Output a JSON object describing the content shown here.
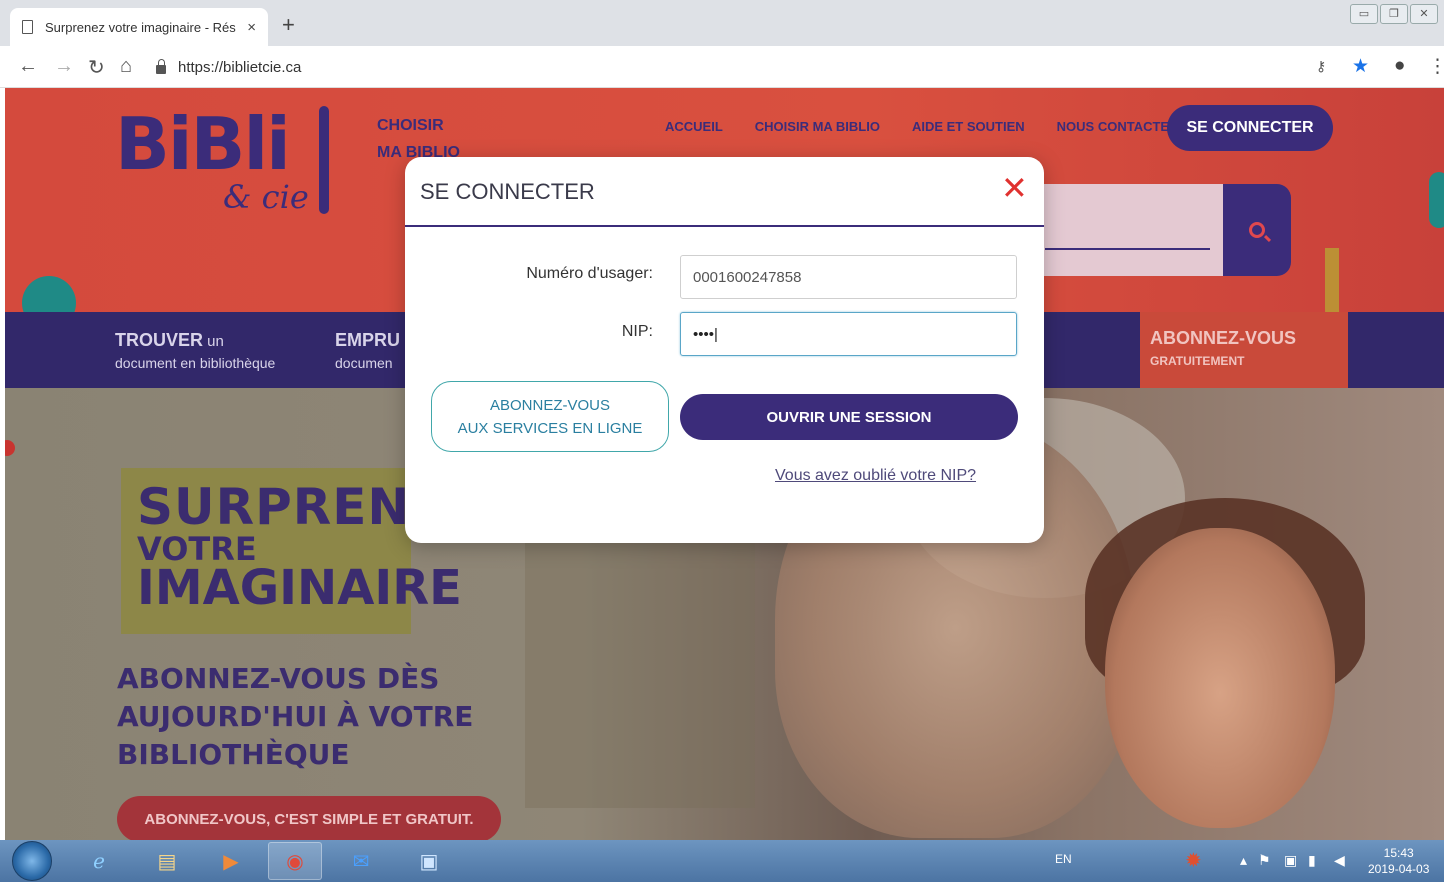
{
  "browser": {
    "tab_title": "Surprenez votre imaginaire - Rés",
    "tab_close": "×",
    "new_tab": "+",
    "url": "https://biblietcie.ca"
  },
  "site": {
    "logo": "BiBli",
    "logo_sub": "& cie",
    "choisir_line1": "CHOISIR",
    "choisir_line2": "MA BIBLIO",
    "nav": [
      "ACCUEIL",
      "CHOISIR MA BIBLIO",
      "AIDE ET SOUTIEN",
      "NOUS CONTACTER"
    ],
    "connect_button": "SE CONNECTER",
    "categories": [
      {
        "title": "TROUVER",
        "title_small": " un",
        "sub": "document en bibliothèque"
      },
      {
        "title": "EMPRU",
        "sub": "documen"
      }
    ],
    "abonnez_title": "ABONNEZ-VOUS",
    "abonnez_sub": "GRATUITEMENT",
    "hero_line1": "SURPRENE",
    "hero_line2": "VOTRE",
    "hero_line3": "IMAGINAIRE",
    "hero_sub1": "ABONNEZ-VOUS DÈS",
    "hero_sub2": "AUJOURD'HUI À VOTRE",
    "hero_sub3": "BIBLIOTHÈQUE",
    "hero_cta": "ABONNEZ-VOUS, C'EST SIMPLE ET GRATUIT."
  },
  "modal": {
    "title": "SE CONNECTER",
    "close": "✕",
    "user_label": "Numéro d'usager:",
    "user_value": "0001600247858",
    "pin_label": "NIP:",
    "pin_value": "••••|",
    "subscribe_line1": "ABONNEZ-VOUS",
    "subscribe_line2": "AUX SERVICES EN LIGNE",
    "open_session": "OUVRIR UNE SESSION",
    "forgot": "Vous avez oublié votre NIP?"
  },
  "taskbar": {
    "lang": "EN",
    "time": "15:43",
    "date": "2019-04-03"
  },
  "colors": {
    "brand_purple": "#3b2c7a",
    "brand_red": "#d44a3d",
    "teal": "#1f8a86",
    "close_red": "#e0312f"
  }
}
